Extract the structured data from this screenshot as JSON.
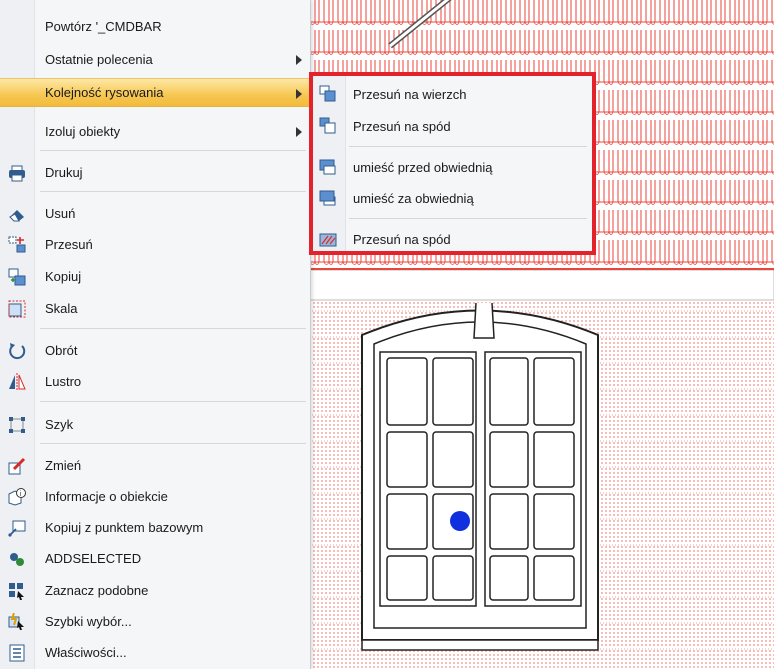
{
  "context_menu": {
    "items": [
      {
        "label": "Powtórz '_CMDBAR",
        "icon": "none"
      },
      {
        "label": "Ostatnie polecenia",
        "icon": "none",
        "submenu": true
      },
      {
        "label": "Kolejność rysowania",
        "icon": "none",
        "submenu": true,
        "active": true
      },
      {
        "label": "Izoluj obiekty",
        "icon": "none",
        "submenu": true
      },
      {
        "label": "Drukuj",
        "icon": "printer-icon"
      },
      {
        "label": "Usuń",
        "icon": "eraser-icon"
      },
      {
        "label": "Przesuń",
        "icon": "move-icon"
      },
      {
        "label": "Kopiuj",
        "icon": "copy-icon"
      },
      {
        "label": "Skala",
        "icon": "scale-icon"
      },
      {
        "label": "Obrót",
        "icon": "rotate-icon"
      },
      {
        "label": "Lustro",
        "icon": "mirror-icon"
      },
      {
        "label": "Szyk",
        "icon": "array-icon"
      },
      {
        "label": "Zmień",
        "icon": "change-icon"
      },
      {
        "label": "Informacje o obiekcie",
        "icon": "object-info-icon"
      },
      {
        "label": "Kopiuj z punktem bazowym",
        "icon": "copy-base-point-icon"
      },
      {
        "label": "ADDSELECTED",
        "icon": "add-selected-icon"
      },
      {
        "label": "Zaznacz podobne",
        "icon": "select-similar-icon"
      },
      {
        "label": "Szybki wybór...",
        "icon": "quick-select-icon"
      },
      {
        "label": "Właściwości...",
        "icon": "properties-icon"
      }
    ]
  },
  "draw_order_submenu": {
    "items": [
      {
        "label": "Przesuń na wierzch",
        "icon": "bring-to-front-icon"
      },
      {
        "label": "Przesuń na spód",
        "icon": "send-to-back-icon"
      },
      {
        "label": "umieść przed obwiednią",
        "icon": "bring-above-boundary-icon"
      },
      {
        "label": "umieść za obwiednią",
        "icon": "send-under-boundary-icon"
      },
      {
        "label": "Przesuń na spód",
        "icon": "send-hatch-to-back-icon"
      }
    ]
  },
  "colors": {
    "highlight_border": "#e3232c",
    "drawing_lines": "#e8463c",
    "grip": "#1030e0",
    "menu_hover": "#f6c752"
  }
}
